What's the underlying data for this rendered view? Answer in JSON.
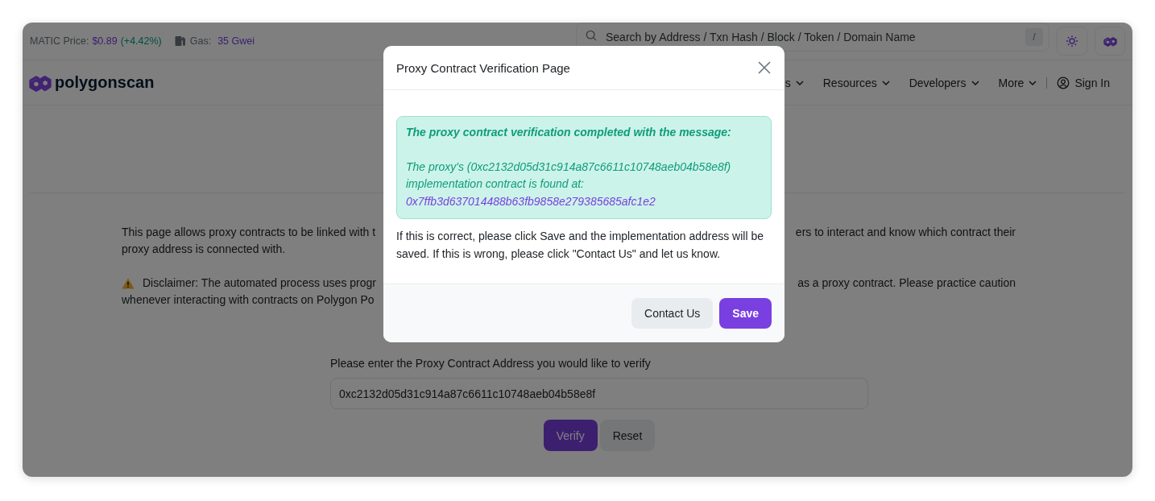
{
  "topbar": {
    "price_label": "MATIC Price:",
    "price_value": "$0.89",
    "price_change": "(+4.42%)",
    "gas_label": "Gas:",
    "gas_value": "35 Gwei",
    "search": {
      "placeholder": "Search by Address / Txn Hash / Block / Token / Domain Name"
    },
    "search_key": "/"
  },
  "navbar": {
    "logo": "polygonscan",
    "items": [
      {
        "label": "s"
      },
      {
        "label": "Resources"
      },
      {
        "label": "Developers"
      },
      {
        "label": "More"
      }
    ],
    "sign_in": "Sign In"
  },
  "intro_lines": [
    {
      "left": "This page allows proxy contracts to be linked with t",
      "right": "ers to interact and know which contract their"
    },
    {
      "left": "proxy address is connected with."
    }
  ],
  "disclaimer_lines": [
    {
      "left": "Disclaimer: The automated process uses progr",
      "right": "as a proxy contract. Please practice caution"
    },
    {
      "left": "whenever interacting with contracts on Polygon Po"
    }
  ],
  "form": {
    "label": "Please enter the Proxy Contract Address you would like to verify",
    "address": {
      "value": "0xc2132d05d31c914a87c6611c10748aeb04b58e8f"
    },
    "buttons": [
      {
        "label": "Verify",
        "kind": "primary"
      },
      {
        "label": "Reset",
        "kind": "secondary"
      }
    ]
  },
  "modal": {
    "title": "Proxy Contract Verification Page",
    "alert": {
      "heading": "The proxy contract verification completed with the message:",
      "message": "The proxy's (0xc2132d05d31c914a87c6611c10748aeb04b58e8f) implementation contract is found at:",
      "address": "0x7ffb3d637014488b63fb9858e279385685afc1e2"
    },
    "note": "If this is correct, please click Save and the implementation address will be saved. If this is wrong, please click \"Contact Us\" and let us know.",
    "buttons": [
      {
        "label": "Contact Us",
        "kind": "secondary"
      },
      {
        "label": "Save",
        "kind": "primary"
      }
    ]
  }
}
